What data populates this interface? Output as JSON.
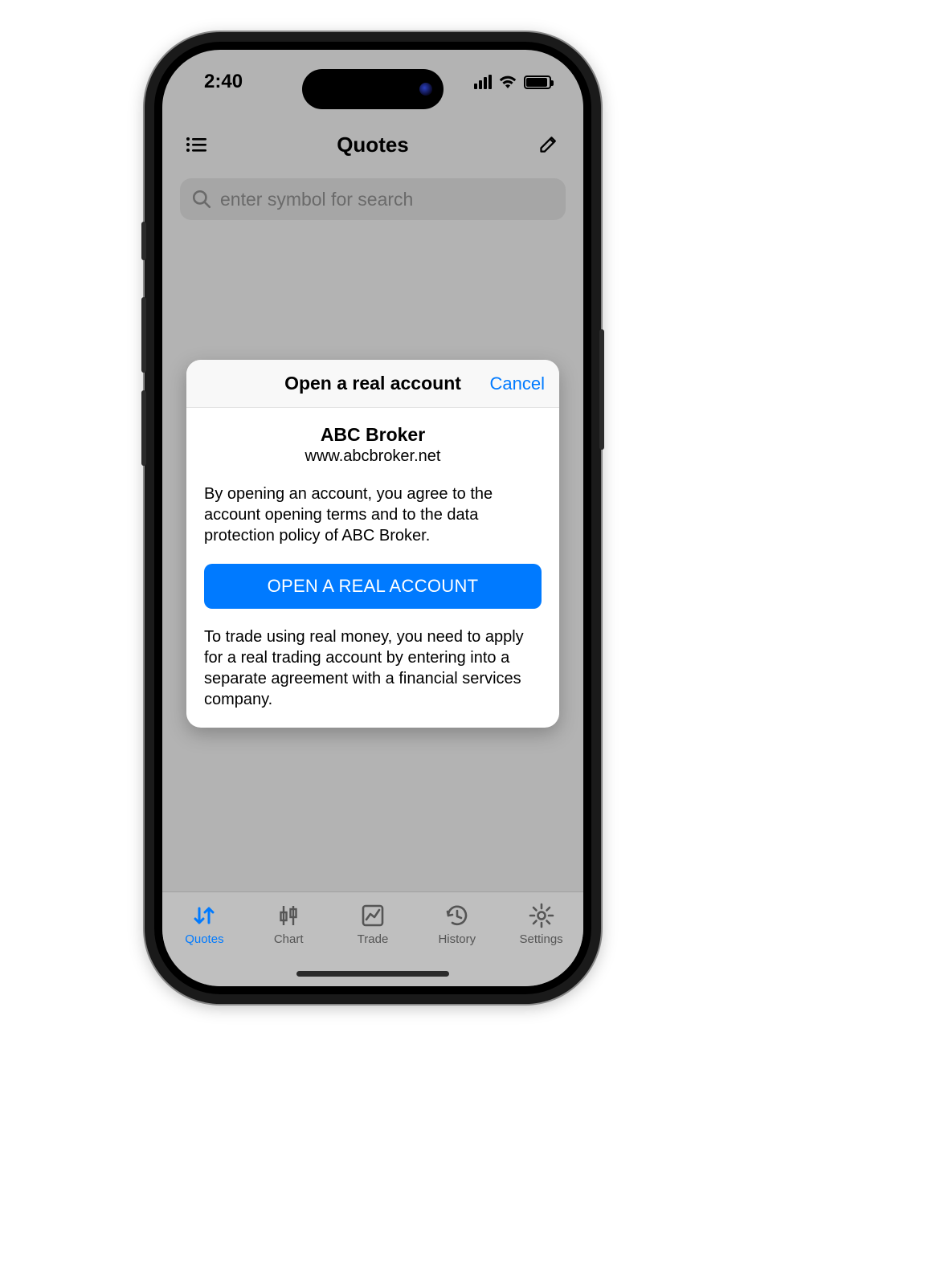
{
  "status": {
    "time": "2:40"
  },
  "header": {
    "title": "Quotes"
  },
  "search": {
    "placeholder": "enter symbol for search"
  },
  "modal": {
    "title": "Open a real account",
    "cancel": "Cancel",
    "broker_name": "ABC Broker",
    "broker_url": "www.abcbroker.net",
    "terms": "By opening an account, you agree to the account opening terms and to the data protection policy of ABC Broker.",
    "cta": "OPEN A REAL ACCOUNT",
    "info": "To trade using real money, you need to apply for a real trading account by entering into a separate agreement with a financial services company."
  },
  "tabs": [
    {
      "label": "Quotes",
      "icon": "arrows-updown-icon",
      "active": true
    },
    {
      "label": "Chart",
      "icon": "candlestick-icon",
      "active": false
    },
    {
      "label": "Trade",
      "icon": "chart-line-icon",
      "active": false
    },
    {
      "label": "History",
      "icon": "clock-history-icon",
      "active": false
    },
    {
      "label": "Settings",
      "icon": "gear-icon",
      "active": false
    }
  ],
  "colors": {
    "accent": "#007aff"
  }
}
